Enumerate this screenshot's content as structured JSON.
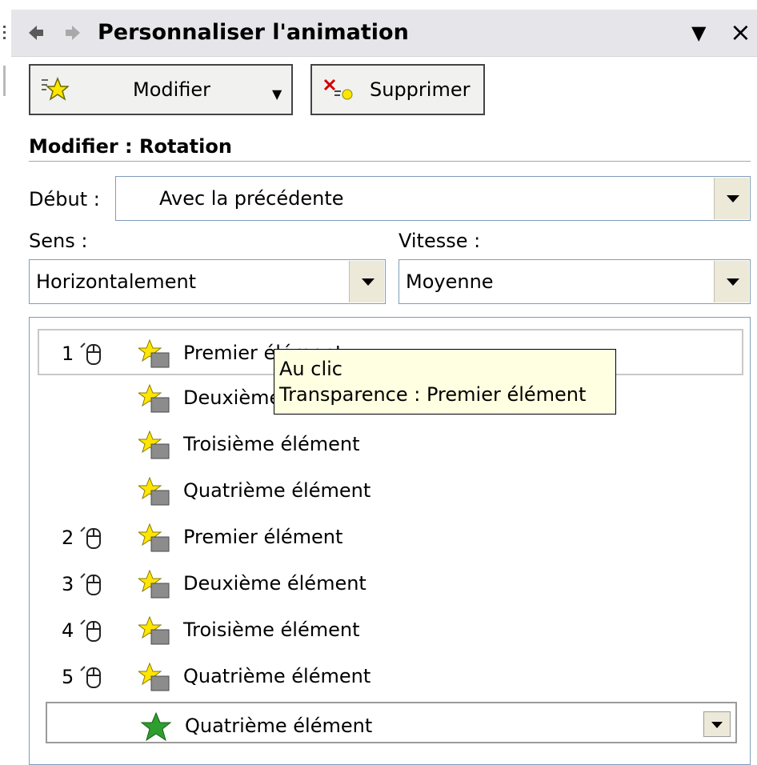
{
  "panel": {
    "title": "Personnaliser l'animation",
    "back_icon": "back-arrow-icon",
    "forward_icon": "forward-arrow-icon",
    "menu_glyph": "▼",
    "close_glyph": "×"
  },
  "toolbar": {
    "modify_label": "Modifier",
    "modify_dropdown": "▼",
    "delete_label": "Supprimer"
  },
  "section": {
    "title": "Modifier : Rotation"
  },
  "start": {
    "label": "Début :",
    "value": "Avec la précédente"
  },
  "direction": {
    "label": "Sens :",
    "value": "Horizontalement"
  },
  "speed": {
    "label": "Vitesse :",
    "value": "Moyenne"
  },
  "list": {
    "items": [
      {
        "num": "1",
        "trigger": "mouse-click-icon",
        "name": "Premier élément"
      },
      {
        "num": "",
        "trigger": "",
        "name": "Deuxième élément"
      },
      {
        "num": "",
        "trigger": "",
        "name": "Troisième élément"
      },
      {
        "num": "",
        "trigger": "",
        "name": "Quatrième élément"
      },
      {
        "num": "2",
        "trigger": "mouse-click-icon",
        "name": "Premier élément"
      },
      {
        "num": "3",
        "trigger": "mouse-click-icon",
        "name": "Deuxième élément"
      },
      {
        "num": "4",
        "trigger": "mouse-click-icon",
        "name": "Troisième élément"
      },
      {
        "num": "5",
        "trigger": "mouse-click-icon",
        "name": "Quatrième élément"
      },
      {
        "num": "",
        "trigger": "",
        "name": "Quatrième élément"
      }
    ]
  },
  "tooltip": {
    "line1": "Au clic",
    "line2": "Transparence : Premier élément"
  }
}
